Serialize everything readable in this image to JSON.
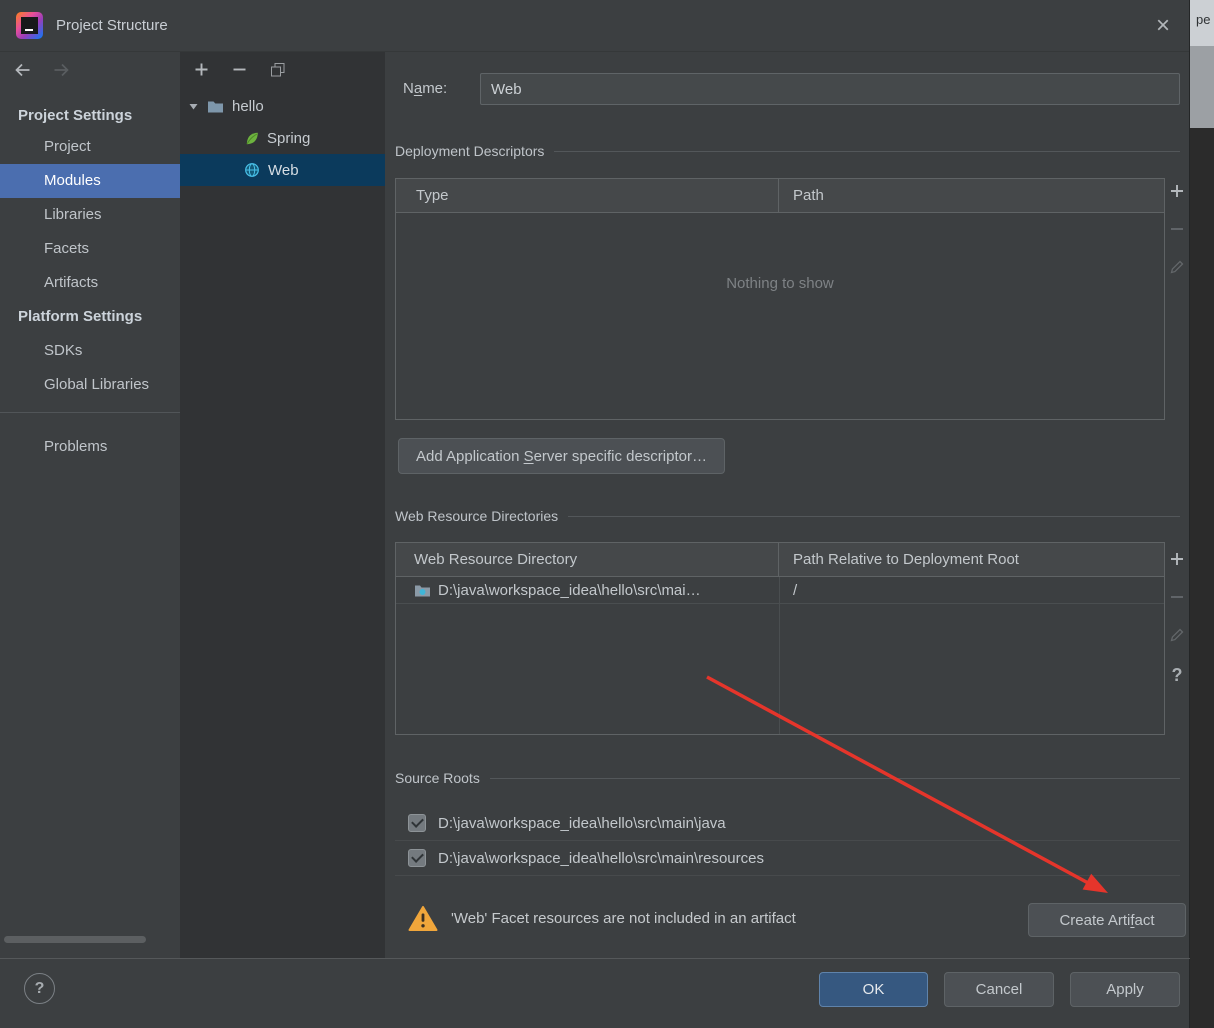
{
  "colors": {
    "dialog_bg": "#3c3f41",
    "tree_panel_bg": "#313335",
    "sidebar_selection": "#4b6eaf",
    "tree_selection": "#0b3a5c",
    "ok_button": "#365880",
    "warning_yellow": "#f0a63b",
    "annotation_red": "#e5352b"
  },
  "titlebar": {
    "title": "Project Structure",
    "close_glyph": "×"
  },
  "icons": {
    "help_glyph": "?"
  },
  "background": {
    "clipped_text": "pe"
  },
  "sidebar": {
    "sections": [
      {
        "header": "Project Settings",
        "items": [
          "Project",
          "Modules",
          "Libraries",
          "Facets",
          "Artifacts"
        ]
      },
      {
        "header": "Platform Settings",
        "items": [
          "SDKs",
          "Global Libraries"
        ]
      }
    ],
    "problems": "Problems",
    "selected_item": "Modules"
  },
  "tree": {
    "root_label": "hello",
    "items": [
      {
        "label": "Spring"
      },
      {
        "label": "Web"
      }
    ],
    "selected_item": "Web"
  },
  "main": {
    "name_label": {
      "pre": "N",
      "mn": "a",
      "post": "me:"
    },
    "name_value": "Web",
    "deployment": {
      "section_title": "Deployment Descriptors",
      "columns": [
        "Type",
        "Path"
      ],
      "empty_text": "Nothing to show",
      "add_button": {
        "pre": "Add Application ",
        "mn": "S",
        "post": "erver specific descriptor…"
      }
    },
    "web_resources": {
      "section_title": "Web Resource Directories",
      "columns": [
        "Web Resource Directory",
        "Path Relative to Deployment Root"
      ],
      "rows": [
        {
          "directory": "D:\\java\\workspace_idea\\hello\\src\\mai…",
          "path": "/"
        }
      ]
    },
    "source_roots": {
      "section_title": "Source Roots",
      "items": [
        {
          "path": "D:\\java\\workspace_idea\\hello\\src\\main\\java",
          "checked": true
        },
        {
          "path": "D:\\java\\workspace_idea\\hello\\src\\main\\resources",
          "checked": true
        }
      ]
    },
    "warning": {
      "text": "'Web' Facet resources are not included in an artifact",
      "button": {
        "pre": "Create Arti",
        "mn": "f",
        "post": "act"
      }
    }
  },
  "footer": {
    "help_glyph": "?",
    "ok": "OK",
    "cancel": "Cancel",
    "apply": "Apply"
  }
}
